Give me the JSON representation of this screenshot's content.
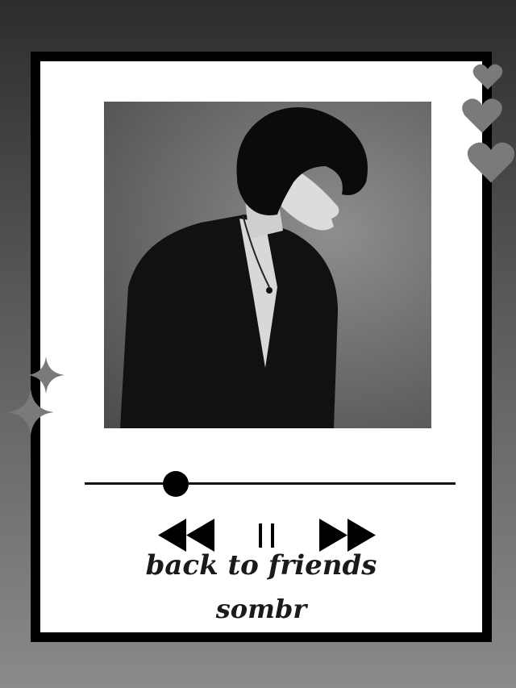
{
  "track": {
    "title": "back to friends",
    "artist": "sombr",
    "progress_fraction": 0.245
  },
  "controls": {
    "rewind_icon": "rewind-icon",
    "pause_icon": "pause-icon",
    "fast_forward_icon": "fast-forward-icon"
  },
  "decorations": {
    "hearts": [
      "heart-icon",
      "heart-icon",
      "heart-icon"
    ],
    "sparkles": [
      "sparkle-icon",
      "sparkle-icon"
    ]
  },
  "colors": {
    "card_border": "#000000",
    "card_bg": "#ffffff",
    "decor_gray": "#7a7a7a",
    "text": "#1a1a1a"
  }
}
